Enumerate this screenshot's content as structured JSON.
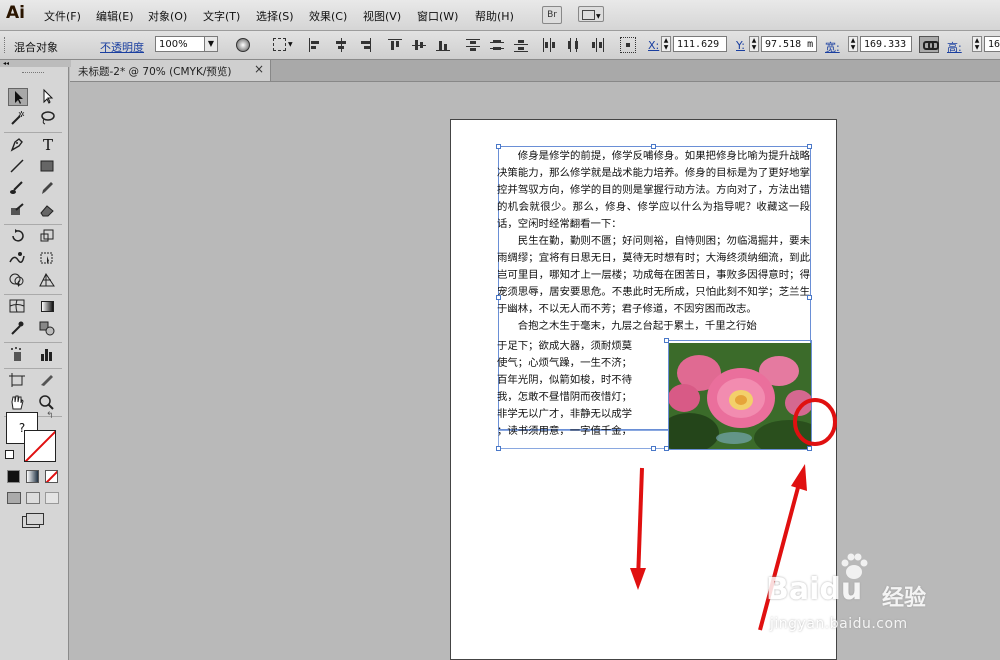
{
  "app": {
    "logo": "Ai",
    "bridge_label": "Br"
  },
  "menu": [
    "文件(F)",
    "编辑(E)",
    "对象(O)",
    "文字(T)",
    "选择(S)",
    "效果(C)",
    "视图(V)",
    "窗口(W)",
    "帮助(H)"
  ],
  "control_bar": {
    "object_type": "混合对象",
    "opacity_label": "不透明度",
    "opacity_value": "100%",
    "x_label": "X:",
    "x_value": "111.629 |",
    "y_label": "Y:",
    "y_value": "97.518 m",
    "w_label": "宽:",
    "w_value": "169.333 |",
    "h_label": "高:",
    "h_value": "16▸"
  },
  "document_tab": {
    "title": "未标题-2* @ 70% (CMYK/预览)",
    "close": "×"
  },
  "toolbox": {
    "stroke_fill_label": "?"
  },
  "document": {
    "paragraphs": [
      "修身是修学的前提，修学反哺修身。如果把修身比喻为提升战略决策能力，那么修学就是战术能力培养。修身的目标是为了更好地掌控并驾驭方向，修学的目的则是掌握行动方法。方向对了，方法出错的机会就很少。那么，修身、修学应以什么为指导呢？收藏这一段话，空闲时经常翻看一下：",
      "民生在勤，勤则不匮；好问则裕，自恃则困；勿临渴掘井，要未雨绸缪；宜将有日思无日，莫待无时想有时；大海终须纳细流，到此岂可里目，哪知才上一层楼；功成每在困苦日，事败多因得意时；得宠须思辱，居安要思危。不患此时无所成，只怕此刻不知学；芝兰生于幽林，不以无人而不芳；君子修道，不因穷困而改志。",
      "合抱之木生于毫末，九层之台起于累土，千里之行始"
    ],
    "wrap_lines": [
      "于足下；欲成大器，须耐烦莫",
      "使气；心烦气躁，一生不济；",
      "百年光阴，似箭如梭，时不待",
      "我，怎敢不昼惜阴而夜惜灯；",
      "非学无以广才，非静无以成学",
      "；读书须用意，一字值千金，"
    ]
  },
  "watermark": {
    "brand": "Baidu",
    "cn": "经验",
    "url": "jingyan.baidu.com"
  },
  "colors": {
    "selection": "#4a78c8",
    "annotation": "#e01010"
  }
}
